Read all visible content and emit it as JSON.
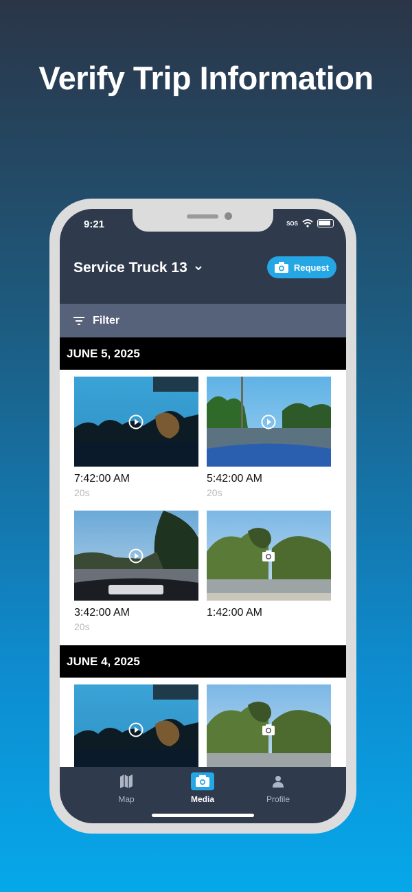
{
  "headline": "Verify Trip Information",
  "status": {
    "time": "9:21",
    "sos": "SOS"
  },
  "header": {
    "vehicle": "Service Truck 13",
    "request_label": "Request"
  },
  "filter": {
    "label": "Filter"
  },
  "groups": [
    {
      "date": "JUNE 5, 2025",
      "items": [
        {
          "time": "7:42:00 AM",
          "duration": "20s",
          "kind": "video"
        },
        {
          "time": "5:42:00 AM",
          "duration": "20s",
          "kind": "video"
        },
        {
          "time": "3:42:00 AM",
          "duration": "20s",
          "kind": "video"
        },
        {
          "time": "1:42:00 AM",
          "duration": "",
          "kind": "photo"
        }
      ]
    },
    {
      "date": "JUNE 4, 2025",
      "items": [
        {
          "time": "",
          "duration": "",
          "kind": "video"
        },
        {
          "time": "",
          "duration": "",
          "kind": "photo"
        }
      ]
    }
  ],
  "tabs": [
    {
      "label": "Map",
      "icon": "map-icon"
    },
    {
      "label": "Media",
      "icon": "camera-icon",
      "active": true
    },
    {
      "label": "Profile",
      "icon": "person-icon"
    }
  ],
  "colors": {
    "accent": "#24a7e4",
    "header": "#2f3a4d",
    "filter": "#56617a"
  }
}
